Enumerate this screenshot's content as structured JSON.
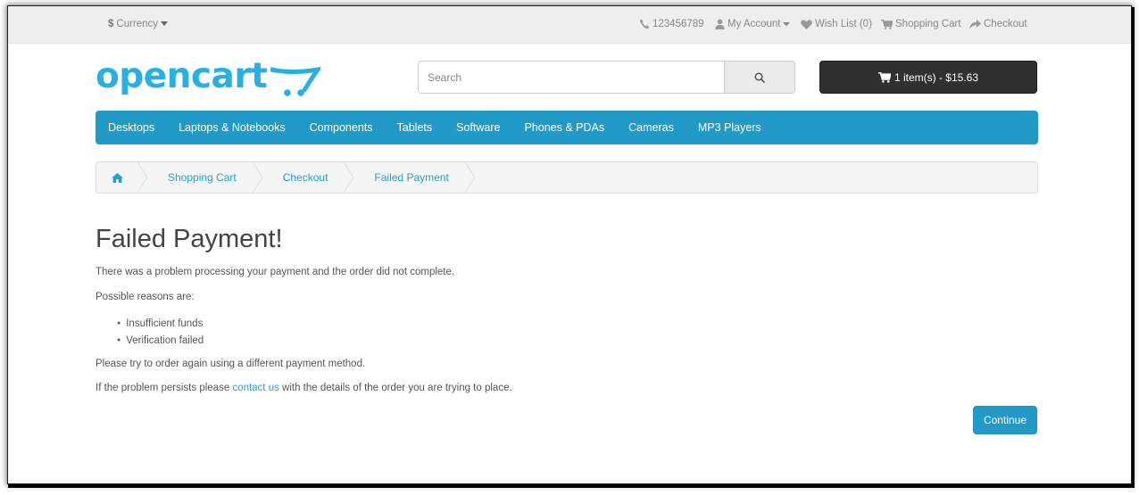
{
  "topbar": {
    "currency_label": "Currency",
    "phone": "123456789",
    "my_account": "My Account",
    "wish_list": "Wish List (0)",
    "shopping_cart": "Shopping Cart",
    "checkout": "Checkout"
  },
  "header": {
    "logo_text": "opencart",
    "search_placeholder": "Search",
    "cart_summary": "1 item(s) - $15.63"
  },
  "menu": {
    "items": [
      "Desktops",
      "Laptops & Notebooks",
      "Components",
      "Tablets",
      "Software",
      "Phones & PDAs",
      "Cameras",
      "MP3 Players"
    ]
  },
  "breadcrumb": {
    "items": [
      "Shopping Cart",
      "Checkout",
      "Failed Payment"
    ]
  },
  "content": {
    "title": "Failed Payment!",
    "p1": "There was a problem processing your payment and the order did not complete.",
    "p2": "Possible reasons are:",
    "reasons": [
      "Insufficient funds",
      "Verification failed"
    ],
    "p3": "Please try to order again using a different payment method.",
    "p4_before": "If the problem persists please ",
    "p4_link": "contact us",
    "p4_after": " with the details of the order you are trying to place.",
    "continue_label": "Continue"
  },
  "colors": {
    "brand": "#229ac8",
    "link": "#23a1d1",
    "logo": "#2ab0e0",
    "cart_button": "#303030"
  },
  "icons": {
    "currency": "dollar-icon",
    "caret": "caret-down-icon",
    "phone": "phone-icon",
    "account": "user-icon",
    "wishlist": "heart-icon",
    "cart": "shopping-cart-icon",
    "checkout": "share-icon",
    "search": "search-icon",
    "home": "home-icon"
  }
}
